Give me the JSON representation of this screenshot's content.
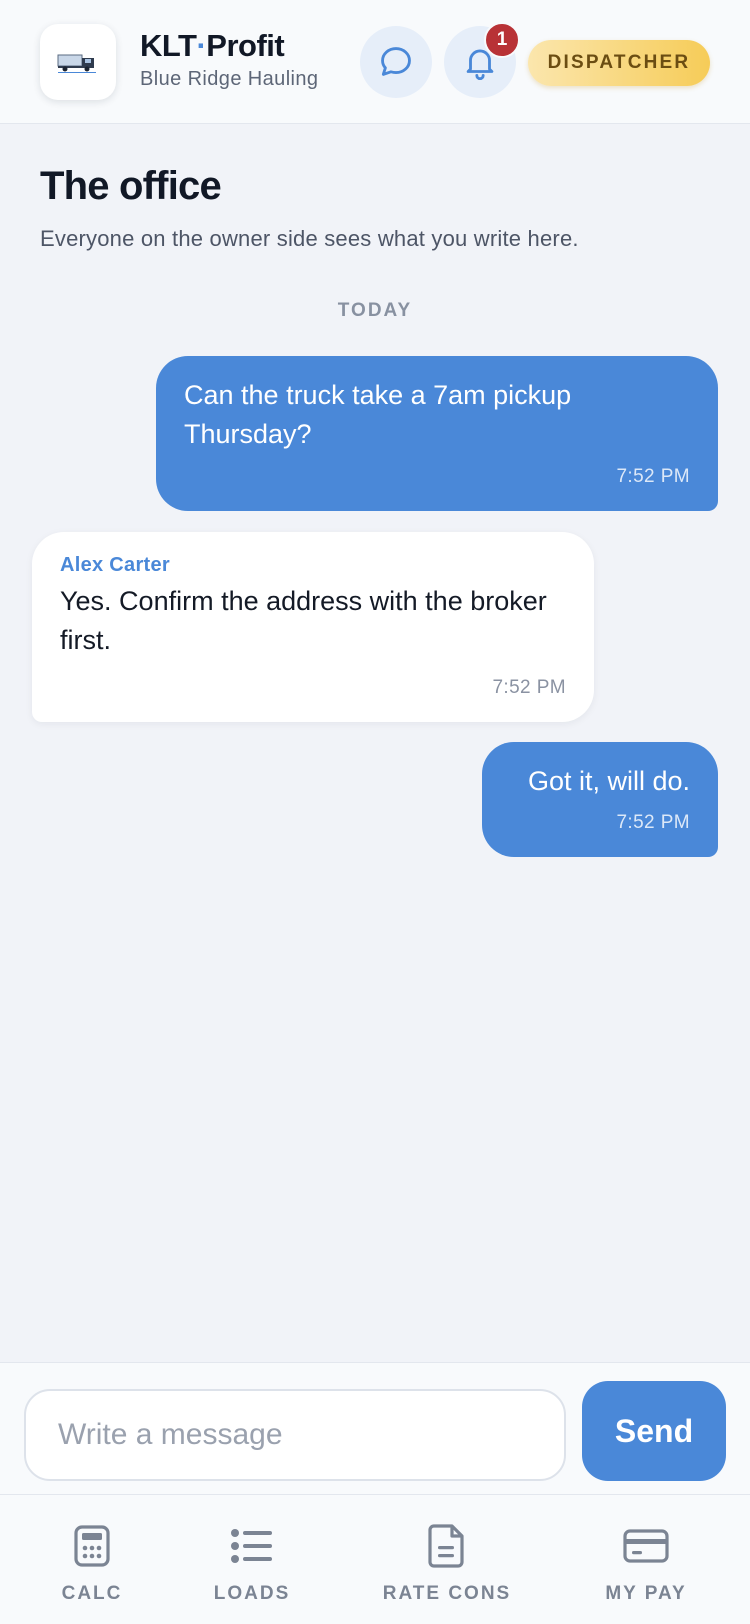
{
  "header": {
    "brand_main_left": "KLT",
    "brand_dot": "·",
    "brand_main_right": "Profit",
    "company": "Blue Ridge Hauling",
    "notification_count": "1",
    "role": "DISPATCHER"
  },
  "page": {
    "title": "The office",
    "subtitle": "Everyone on the owner side sees what you write here."
  },
  "day_separator": "TODAY",
  "messages": [
    {
      "direction": "out",
      "text": "Can the truck take a 7am pickup Thursday?",
      "time": "7:52 PM"
    },
    {
      "direction": "in",
      "sender": "Alex Carter",
      "text": "Yes. Confirm the address with the broker first.",
      "time": "7:52 PM"
    },
    {
      "direction": "out",
      "text": "Got it, will do.",
      "time": "7:52 PM"
    }
  ],
  "composer": {
    "placeholder": "Write a message",
    "value": "",
    "send_label": "Send"
  },
  "nav": {
    "items": [
      {
        "label": "CALC",
        "icon": "calculator-icon"
      },
      {
        "label": "LOADS",
        "icon": "list-icon"
      },
      {
        "label": "RATE CONS",
        "icon": "document-icon"
      },
      {
        "label": "MY PAY",
        "icon": "credit-card-icon"
      }
    ]
  },
  "colors": {
    "accent": "#4a88d8",
    "badge": "#b83236",
    "role_pill": "#f6cc58",
    "background": "#f1f3f8"
  }
}
